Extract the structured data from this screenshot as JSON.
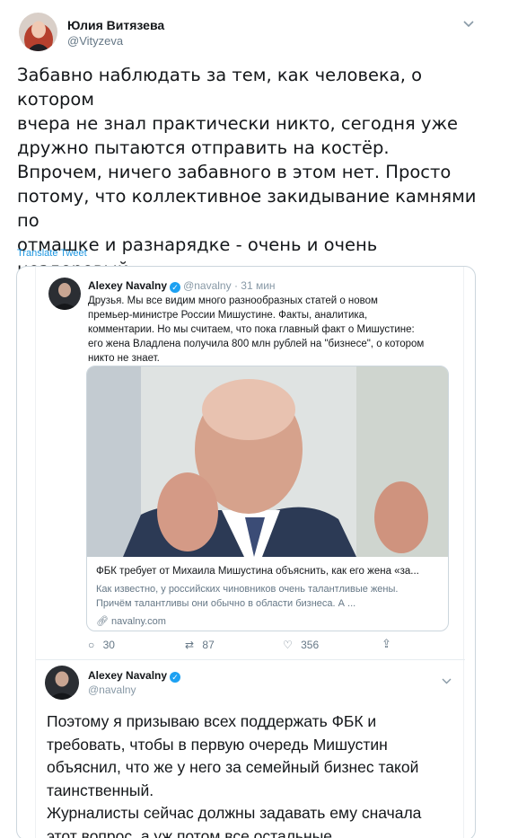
{
  "tweet": {
    "author_name": "Юлия Витязева",
    "author_handle": "@Vityzeva",
    "text": "Забавно наблюдать за тем, как человека, о котором\nвчера не знал практически никто, сегодня уже\nдружно пытаются отправить на костёр.\nВпрочем, ничего забавного в этом нет. Просто\nпотому, что коллективное закидывание камнями по\nотмашке и разнарядке - очень и очень нездоровый\nсимптом",
    "translate_label": "Translate Tweet"
  },
  "quoted_image": {
    "tweet1": {
      "author_name": "Alexey Navalny",
      "author_handle": "@navalny",
      "time": "· 31 мин",
      "text": "Друзья. Мы все видим много разнообразных статей о новом\nпремьер-министре России Мишустине. Факты, аналитика,\nкомментарии. Но мы считаем, что пока главный факт о Мишустине:\nего жена Владлена получила 800 млн рублей на \"бизнесе\", о котором\nникто не знает.",
      "card": {
        "title": "ФБК требует от Михаила Мишустина объяснить, как его жена «за...",
        "description": "Как известно, у российских чиновников очень талантливые жены.\nПричём талантливы они обычно в области бизнеса. А ...",
        "link": "navalny.com"
      },
      "replies": "30",
      "retweets": "87",
      "likes": "356"
    },
    "tweet2": {
      "author_name": "Alexey Navalny",
      "author_handle": "@navalny",
      "text": "Поэтому я призываю всех поддержать ФБК и\nтребовать, чтобы в первую очередь Мишустин\nобъяснил, что же у него за семейный бизнес такой\nтаинственный.\nЖурналисты сейчас должны задавать ему сначала\nэтот вопрос, а уж потом все остальные."
    }
  },
  "icons": {
    "menu": "chevron-down-icon",
    "verified": "verified-badge-icon",
    "reply": "reply-icon",
    "retweet": "retweet-icon",
    "like": "heart-icon",
    "share": "share-icon",
    "link": "link-icon"
  },
  "colors": {
    "link_blue": "#1b95e0",
    "verified_blue": "#1da1f2",
    "secondary_text": "#657786"
  }
}
